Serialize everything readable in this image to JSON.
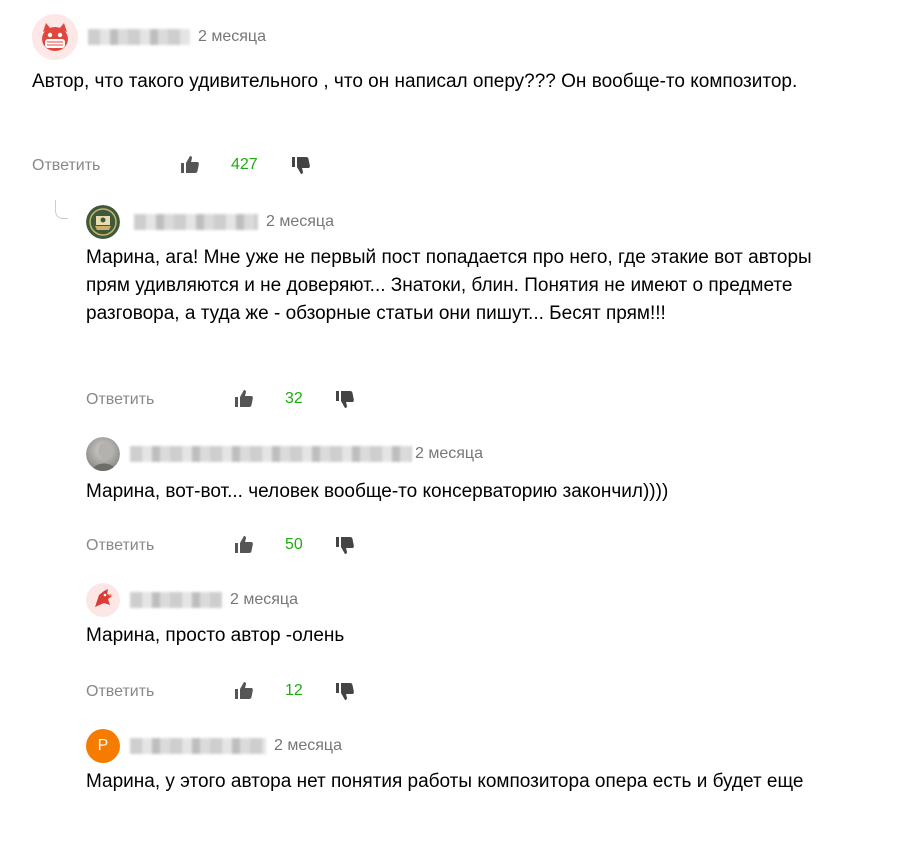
{
  "ui": {
    "reply_label": "Ответить"
  },
  "comments": [
    {
      "time": "2 месяца",
      "text": "Автор, что такого удивительного , что он написал оперу??? Он вообще-то композитор.",
      "likes": "427",
      "avatar_icon": "red-cat-mask-avatar"
    },
    {
      "time": "2 месяца",
      "text": "Марина, ага! Мне уже не первый пост попадается про него, где этакие вот авторы прям удивляются и не доверяют... Знатоки, блин. Понятия не имеют о предмете разговора, а туда же - обзорные статьи они пишут... Бесят прям!!!",
      "likes": "32",
      "avatar_icon": "green-emblem-avatar"
    },
    {
      "time": "2 месяца",
      "text": "Марина, вот-вот... человек вообще-то консерваторию закончил))))",
      "likes": "50",
      "avatar_icon": "photo-avatar"
    },
    {
      "time": "2 месяца",
      "text": "Марина, просто автор -олень",
      "likes": "12",
      "avatar_icon": "red-bird-avatar"
    },
    {
      "time": "2 месяца",
      "text": "Марина, у этого автора нет понятия работы композитора опера есть и будет еще",
      "likes": "",
      "avatar_letter": "Р",
      "avatar_color": "#f57c00"
    }
  ],
  "colors": {
    "like_count": "#1fab10",
    "muted": "#777777"
  }
}
